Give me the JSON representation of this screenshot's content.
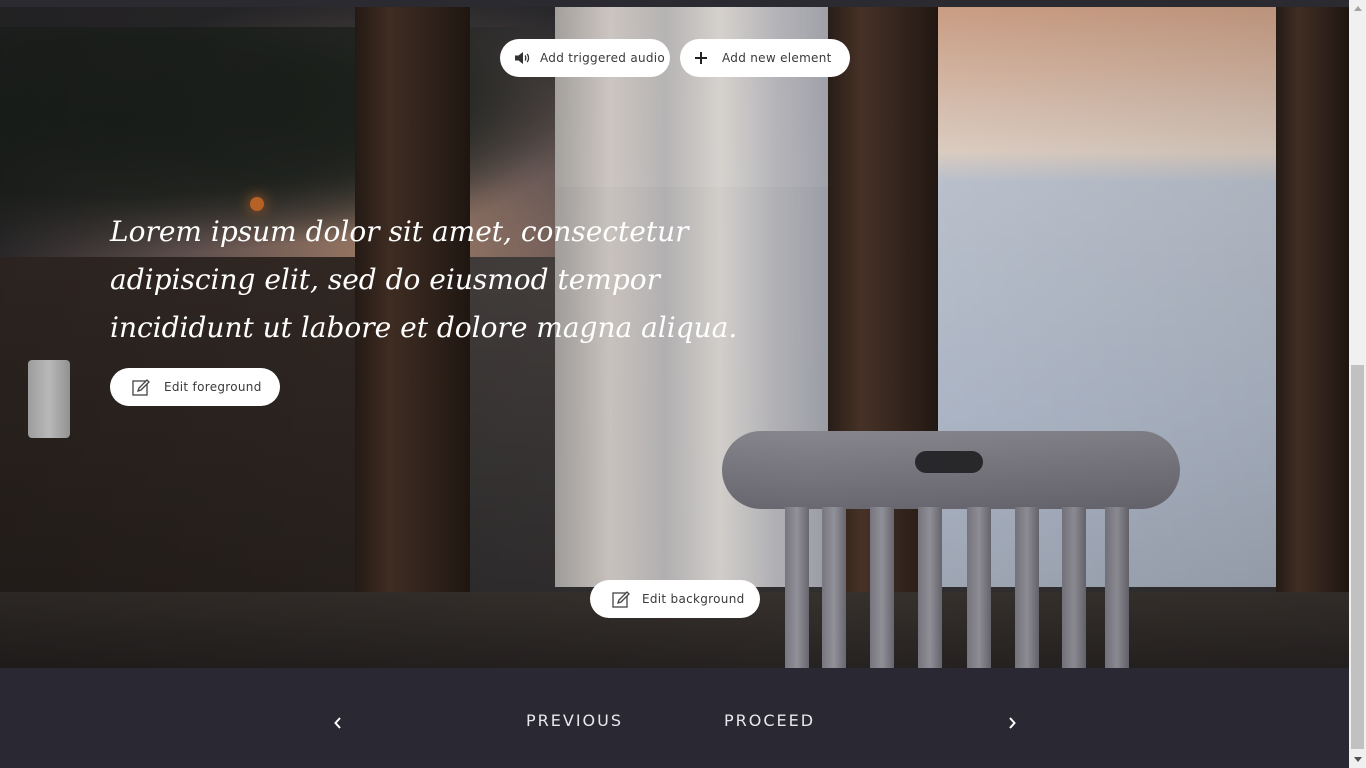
{
  "toolbar": {
    "audio_label": "Add triggered audio",
    "audio_icon": "speaker-icon",
    "new_label": "Add new element",
    "new_icon": "plus-icon"
  },
  "content": {
    "quote": "Lorem ipsum dolor sit amet, consectetur adipiscing elit, sed do eiusmod tempor incididunt ut labore et dolore magna aliqua."
  },
  "actions": {
    "edit_foreground_label": "Edit foreground",
    "edit_background_label": "Edit background",
    "edit_icon": "edit-icon"
  },
  "navigation": {
    "previous_label": "PREVIOUS",
    "proceed_label": "PROCEED",
    "prev_arrow": "‹",
    "next_arrow": "›"
  },
  "colors": {
    "footer_bg": "#2a2832",
    "pill_bg": "#ffffff",
    "quote_text": "#ffffff"
  }
}
